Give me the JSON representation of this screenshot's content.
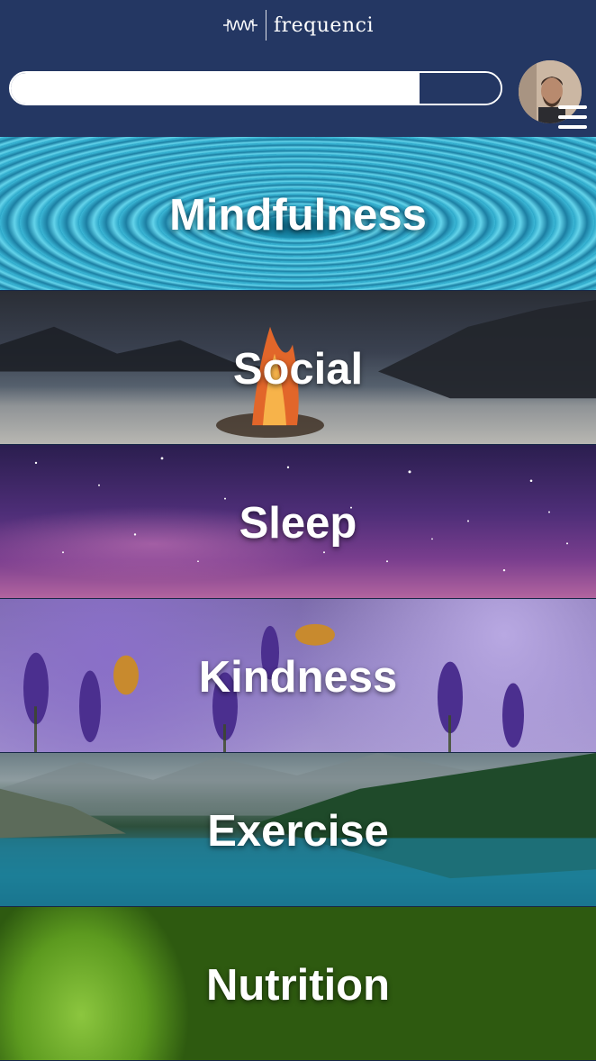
{
  "header": {
    "logo_text": "frequenci",
    "logo_icon": "waveform-icon",
    "search": {
      "placeholder": "",
      "value": ""
    },
    "avatar": "user-avatar",
    "menu_icon": "hamburger-menu-icon"
  },
  "categories": [
    {
      "label": "Mindfulness",
      "background": "water-ripple"
    },
    {
      "label": "Social",
      "background": "campfire-beach"
    },
    {
      "label": "Sleep",
      "background": "purple-night-sky"
    },
    {
      "label": "Kindness",
      "background": "lavender-bees"
    },
    {
      "label": "Exercise",
      "background": "mountain-lake-forest"
    },
    {
      "label": "Nutrition",
      "background": "avocados"
    }
  ],
  "colors": {
    "header_bg": "#243763",
    "text": "#ffffff"
  }
}
